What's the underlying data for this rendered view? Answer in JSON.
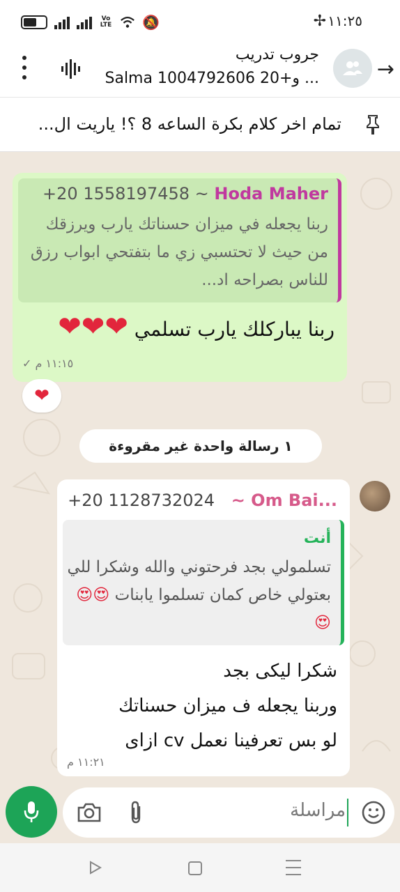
{
  "status_bar": {
    "time": "١١:٢٥",
    "volte": "Vo LTE"
  },
  "header": {
    "title": "جروب تدريب",
    "members": "Salma و+20 1004792606 ..."
  },
  "pinned": {
    "text": "تمام اخر كلام بكرة الساعه 8 ؟! ياريت ال..."
  },
  "chat": {
    "outgoing": {
      "quote_name": "Hoda Maher",
      "quote_phone": "+20 1558197458 ~",
      "quote_text": "ربنا يجعله في ميزان حسناتك يارب ويرزقك من حيث لا تحتسبي زي ما بتفتحي ابواب رزق للناس بصراحه اد...",
      "text": "ربنا يباركلك يارب تسلمي",
      "hearts": "❤❤❤",
      "time": "١١:١٥ م",
      "tick": "✓",
      "reaction": "❤"
    },
    "unread_label": "١ رسالة واحدة غير مقروءة",
    "incoming": {
      "sender_name": "~ Om Bai...",
      "sender_phone": "+20 1128732024",
      "quote_author": "أنت",
      "quote_text": "تسلمولي بجد فرحتوني والله وشكرا للي بعتولي خاص كمان تسلموا يابنات",
      "quote_emojis": "😍😍😍",
      "line1": "شكرا ليكى بجد",
      "line2": "وربنا يجعله ف ميزان حسناتك",
      "line3": "لو بس تعرفينا نعمل cv ازاى",
      "time": "١١:٢١ م"
    }
  },
  "input": {
    "placeholder": "مراسلة"
  },
  "colors": {
    "accent_green": "#1da457",
    "outgoing_bubble": "#dcf8c6",
    "quote_name_pink": "#c0399f",
    "heart_red": "#e2263c"
  },
  "icons": [
    "battery-icon",
    "signal-icon",
    "wifi-icon",
    "mute-icon",
    "fan-icon",
    "back-arrow-icon",
    "group-avatar-icon",
    "voice-call-icon",
    "menu-dots-icon",
    "pin-icon",
    "mic-icon",
    "camera-icon",
    "attach-icon",
    "emoji-icon",
    "nav-back-icon",
    "nav-home-icon",
    "nav-recent-icon"
  ]
}
